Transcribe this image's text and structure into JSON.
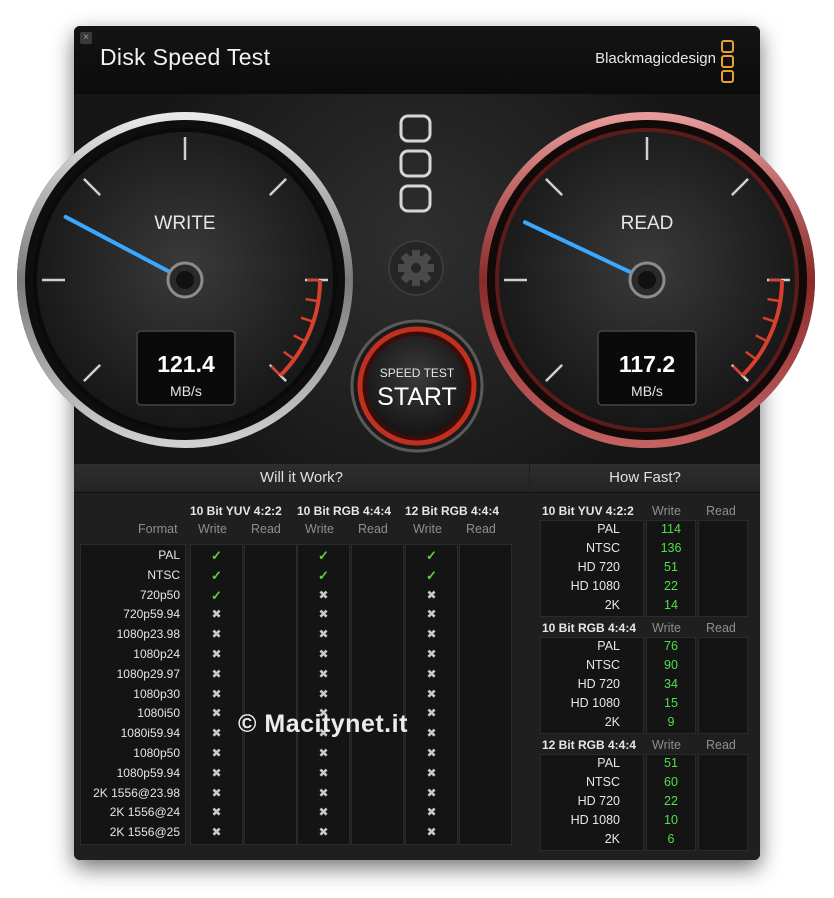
{
  "window": {
    "title": "Disk Speed Test",
    "brand": "Blackmagicdesign",
    "accent": "#e8a035"
  },
  "gauges": {
    "write": {
      "label": "WRITE",
      "value": "121.4",
      "unit": "MB/s",
      "needle_color": "#3aa8ff"
    },
    "read": {
      "label": "READ",
      "value": "117.2",
      "unit": "MB/s",
      "needle_color": "#3aa8ff"
    }
  },
  "start_button": {
    "label_small": "SPEED TEST",
    "label_big": "START"
  },
  "will_it_work": {
    "title": "Will it Work?",
    "format_header": "Format",
    "write_header": "Write",
    "read_header": "Read",
    "groups": [
      "10 Bit YUV 4:2:2",
      "10 Bit RGB 4:4:4",
      "12 Bit RGB 4:4:4"
    ],
    "rows": [
      {
        "format": "PAL",
        "results": [
          "ok",
          "ok",
          "ok"
        ]
      },
      {
        "format": "NTSC",
        "results": [
          "ok",
          "ok",
          "ok"
        ]
      },
      {
        "format": "720p50",
        "results": [
          "ok",
          "no",
          "no"
        ]
      },
      {
        "format": "720p59.94",
        "results": [
          "no",
          "no",
          "no"
        ]
      },
      {
        "format": "1080p23.98",
        "results": [
          "no",
          "no",
          "no"
        ]
      },
      {
        "format": "1080p24",
        "results": [
          "no",
          "no",
          "no"
        ]
      },
      {
        "format": "1080p29.97",
        "results": [
          "no",
          "no",
          "no"
        ]
      },
      {
        "format": "1080p30",
        "results": [
          "no",
          "no",
          "no"
        ]
      },
      {
        "format": "1080i50",
        "results": [
          "no",
          "no",
          "no"
        ]
      },
      {
        "format": "1080i59.94",
        "results": [
          "no",
          "no",
          "no"
        ]
      },
      {
        "format": "1080p50",
        "results": [
          "no",
          "no",
          "no"
        ]
      },
      {
        "format": "1080p59.94",
        "results": [
          "no",
          "no",
          "no"
        ]
      },
      {
        "format": "2K 1556@23.98",
        "results": [
          "no",
          "no",
          "no"
        ]
      },
      {
        "format": "2K 1556@24",
        "results": [
          "no",
          "no",
          "no"
        ]
      },
      {
        "format": "2K 1556@25",
        "results": [
          "no",
          "no",
          "no"
        ]
      }
    ],
    "ok_glyph": "✓",
    "no_glyph": "✖"
  },
  "how_fast": {
    "title": "How Fast?",
    "write_header": "Write",
    "read_header": "Read",
    "groups": [
      {
        "name": "10 Bit YUV 4:2:2",
        "rows": [
          {
            "label": "PAL",
            "write": "114"
          },
          {
            "label": "NTSC",
            "write": "136"
          },
          {
            "label": "HD 720",
            "write": "51"
          },
          {
            "label": "HD 1080",
            "write": "22"
          },
          {
            "label": "2K",
            "write": "14"
          }
        ]
      },
      {
        "name": "10 Bit RGB 4:4:4",
        "rows": [
          {
            "label": "PAL",
            "write": "76"
          },
          {
            "label": "NTSC",
            "write": "90"
          },
          {
            "label": "HD 720",
            "write": "34"
          },
          {
            "label": "HD 1080",
            "write": "15"
          },
          {
            "label": "2K",
            "write": "9"
          }
        ]
      },
      {
        "name": "12 Bit RGB 4:4:4",
        "rows": [
          {
            "label": "PAL",
            "write": "51"
          },
          {
            "label": "NTSC",
            "write": "60"
          },
          {
            "label": "HD 720",
            "write": "22"
          },
          {
            "label": "HD 1080",
            "write": "10"
          },
          {
            "label": "2K",
            "write": "6"
          }
        ]
      }
    ]
  },
  "watermark": "© Macitynet.it"
}
